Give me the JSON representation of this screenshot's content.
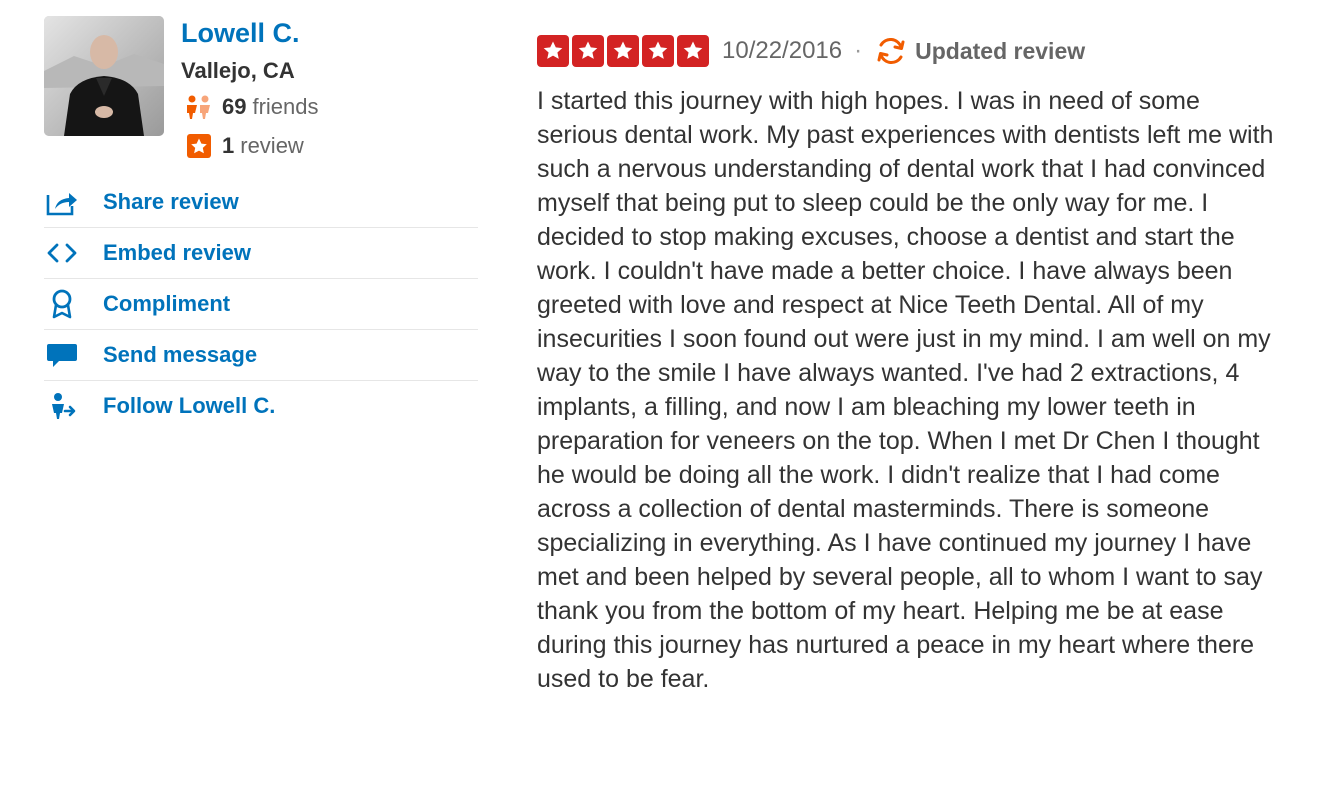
{
  "user": {
    "name": "Lowell C.",
    "location": "Vallejo, CA",
    "friends_count": "69",
    "friends_label": "friends",
    "reviews_count": "1",
    "reviews_label": "review",
    "avatar_icon": "user-photo"
  },
  "actions": {
    "share": {
      "label": "Share review",
      "icon": "share-icon"
    },
    "embed": {
      "label": "Embed review",
      "icon": "embed-code-icon"
    },
    "compliment": {
      "label": "Compliment",
      "icon": "award-ribbon-icon"
    },
    "message": {
      "label": "Send message",
      "icon": "speech-bubble-icon"
    },
    "follow": {
      "label": "Follow Lowell C.",
      "icon": "follow-person-icon"
    }
  },
  "review": {
    "rating": 5,
    "rating_max": 5,
    "date": "10/22/2016",
    "separator": "·",
    "updated_label": "Updated review",
    "text": "I started this journey with high hopes. I was in need of some serious dental work. My past experiences with dentists left me with such a nervous understanding of dental work that I had convinced myself that being put to sleep could be the only way for me. I decided to stop making excuses, choose a dentist and start the work. I couldn't have made a better choice. I have always been greeted with love and respect at Nice Teeth Dental. All of my insecurities I soon found out were just in my mind. I am well on my way to the smile I have always wanted. I've had 2 extractions, 4 implants, a filling, and now I am bleaching my lower teeth in preparation for veneers on the top. When I met Dr Chen I thought he would be doing all the work. I didn't realize that I had come across a collection of dental masterminds. There is someone specializing in everything. As I have continued my journey I have met and been helped by several people, all to whom I want to say thank you from the bottom of my heart. Helping me be at ease during this journey has nurtured a peace in my heart where there used to be fear."
  },
  "colors": {
    "link_blue": "#0073bb",
    "star_red": "#d32323",
    "friends_orange": "#f15c00",
    "text_dark": "#333333",
    "text_gray": "#666666"
  }
}
